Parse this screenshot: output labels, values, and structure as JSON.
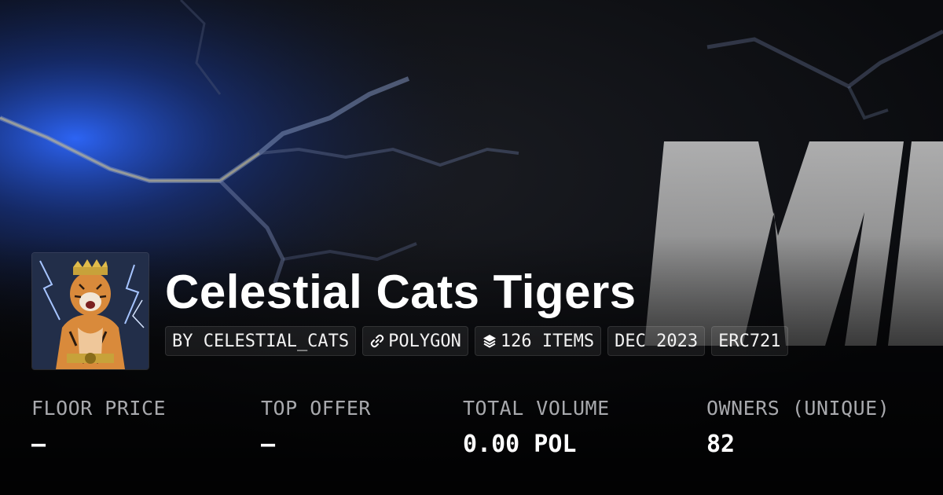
{
  "collection": {
    "title": "Celestial Cats Tigers",
    "avatar_icon": "tiger-warrior-artwork",
    "chips": {
      "creator": "BY CELESTIAL_CATS",
      "chain": "POLYGON",
      "chain_icon": "link-icon",
      "items": "126 ITEMS",
      "items_icon": "layers-icon",
      "date": "DEC 2023",
      "standard": "ERC721"
    }
  },
  "stats": {
    "floor_price": {
      "label": "FLOOR PRICE",
      "value": "–"
    },
    "top_offer": {
      "label": "TOP OFFER",
      "value": "–"
    },
    "total_volume": {
      "label": "TOTAL VOLUME",
      "value": "0.00 POL"
    },
    "owners": {
      "label": "OWNERS (UNIQUE)",
      "value": "82"
    }
  },
  "colors": {
    "background": "#0b0c10",
    "label_gray": "#a8a9ad",
    "accent_blue": "#2f6bff"
  }
}
